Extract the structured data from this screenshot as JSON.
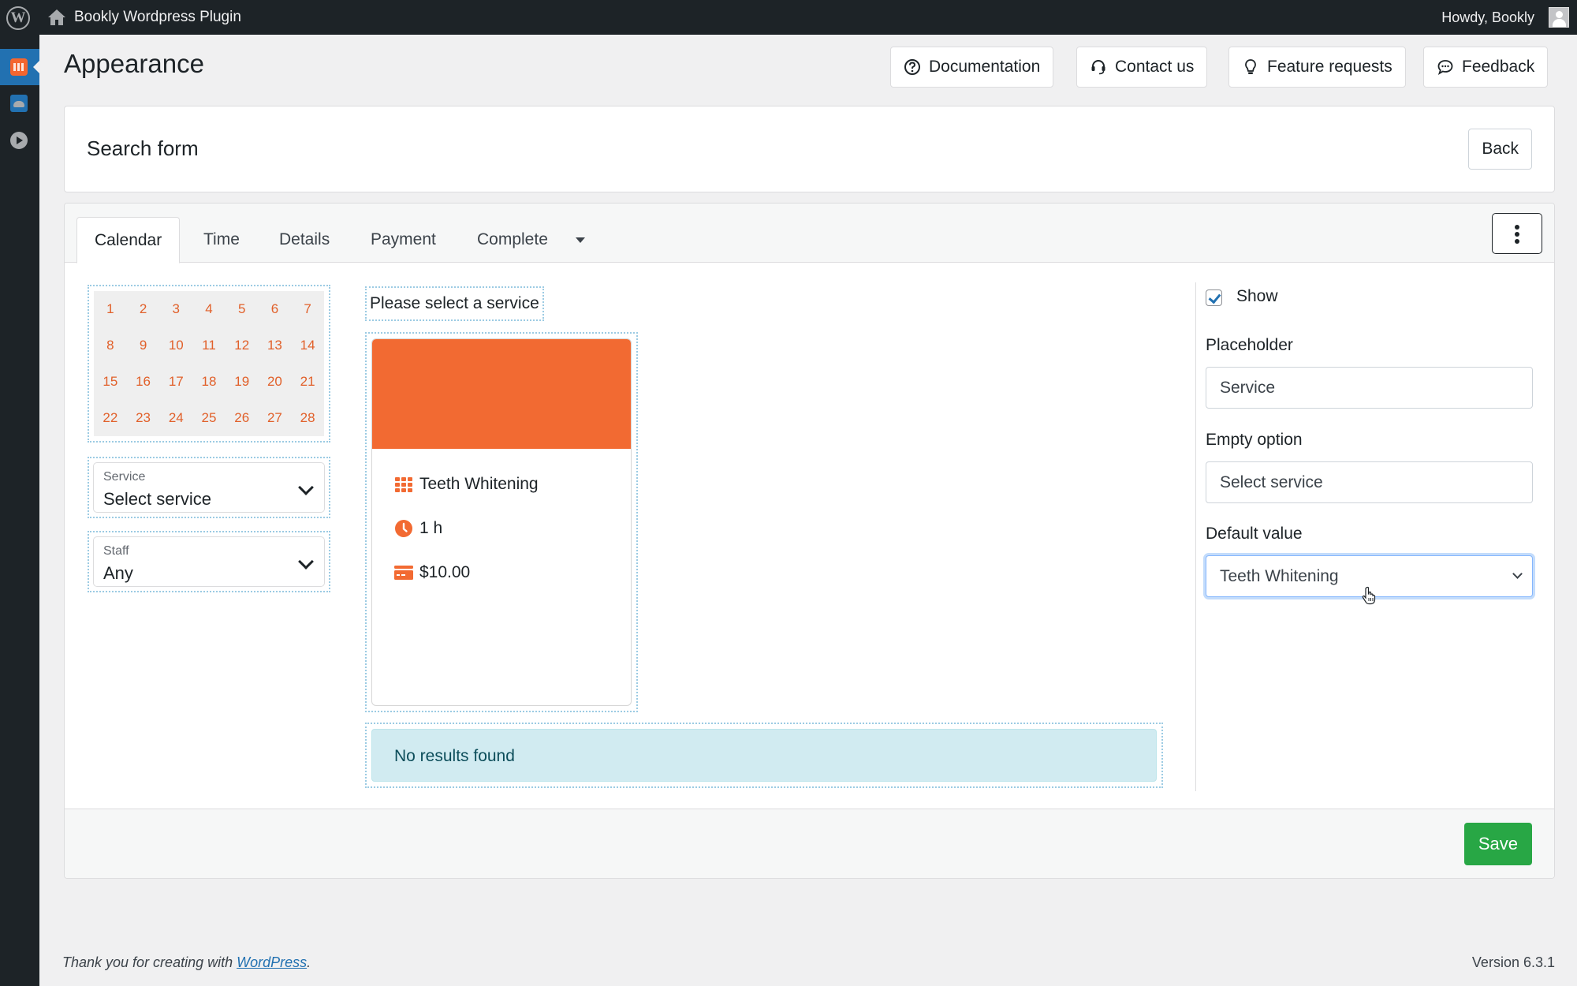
{
  "adminbar": {
    "site_name": "Bookly Wordpress Plugin",
    "howdy": "Howdy, Bookly"
  },
  "sidebar": {
    "items": [
      {
        "icon": "bookly-calendar-icon",
        "active": true
      },
      {
        "icon": "cloud-icon",
        "active": false
      },
      {
        "icon": "play-icon",
        "active": false
      }
    ]
  },
  "header": {
    "title": "Appearance",
    "buttons": [
      {
        "label": "Documentation",
        "icon": "question-circle-icon"
      },
      {
        "label": "Contact us",
        "icon": "headset-icon"
      },
      {
        "label": "Feature requests",
        "icon": "lightbulb-icon"
      },
      {
        "label": "Feedback",
        "icon": "chat-bubble-icon"
      }
    ]
  },
  "search_form": {
    "title": "Search form",
    "back_label": "Back"
  },
  "tabs": [
    {
      "label": "Calendar",
      "active": true
    },
    {
      "label": "Time",
      "active": false
    },
    {
      "label": "Details",
      "active": false
    },
    {
      "label": "Payment",
      "active": false
    },
    {
      "label": "Complete",
      "active": false
    }
  ],
  "calendar": {
    "days": [
      "1",
      "2",
      "3",
      "4",
      "5",
      "6",
      "7",
      "8",
      "9",
      "10",
      "11",
      "12",
      "13",
      "14",
      "15",
      "16",
      "17",
      "18",
      "19",
      "20",
      "21",
      "22",
      "23",
      "24",
      "25",
      "26",
      "27",
      "28"
    ]
  },
  "filters": {
    "service": {
      "label": "Service",
      "value": "Select service"
    },
    "staff": {
      "label": "Staff",
      "value": "Any"
    }
  },
  "preview": {
    "prompt": "Please select a service",
    "service_card": {
      "name": "Teeth Whitening",
      "duration": "1 h",
      "price": "$10.00",
      "color": "#f26a32"
    },
    "no_results": "No results found"
  },
  "settings": {
    "show_label": "Show",
    "show_checked": true,
    "placeholder_label": "Placeholder",
    "placeholder_value": "Service",
    "empty_option_label": "Empty option",
    "empty_option_value": "Select service",
    "default_value_label": "Default value",
    "default_value": "Teeth Whitening"
  },
  "footer": {
    "save_label": "Save",
    "thanks_prefix": "Thank you for creating with ",
    "thanks_link": "WordPress",
    "thanks_suffix": ".",
    "version": "Version 6.3.1"
  }
}
